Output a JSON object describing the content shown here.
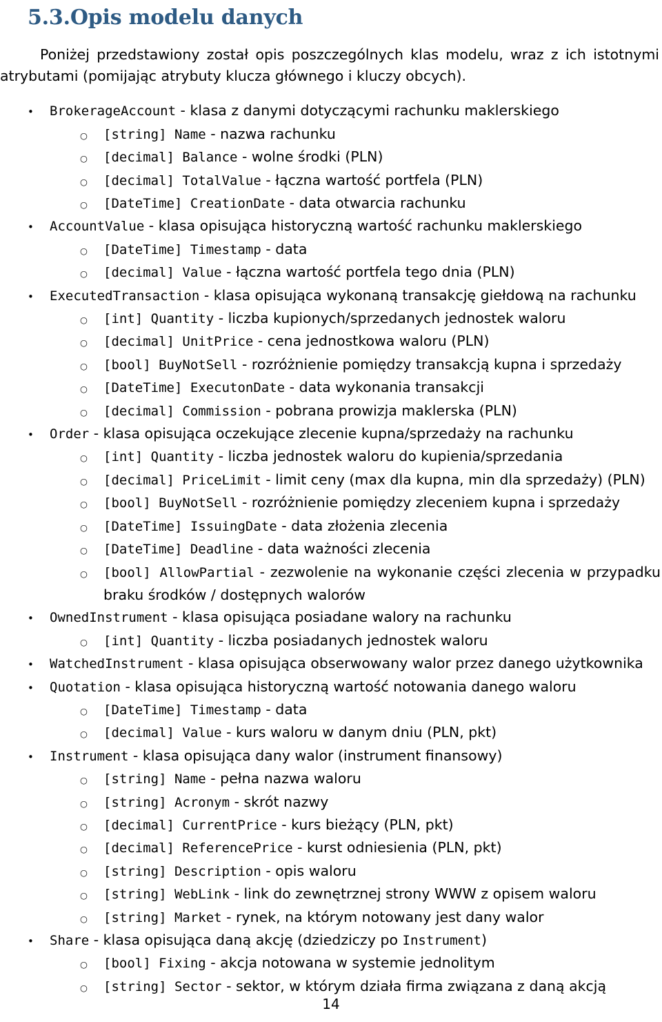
{
  "heading": {
    "number": "5.3.",
    "title": "Opis modelu danych",
    "color": "#2e5b84"
  },
  "intro": "Poniżej przedstawiony został opis poszczególnych klas modelu, wraz z ich istotnymi atrybutami (pomijając atrybuty klucza głównego i kluczy obcych).",
  "bullets": {
    "level1_glyph": "•",
    "level2_glyph": "○"
  },
  "classes": [
    {
      "name": "BrokerageAccount",
      "sep": " - ",
      "desc": "klasa z danymi dotyczącymi rachunku maklerskiego",
      "attributes": [
        {
          "type": "[string]",
          "name": "Name",
          "sep": " - ",
          "desc": "nazwa rachunku"
        },
        {
          "type": "[decimal]",
          "name": "Balance",
          "sep": " - ",
          "desc": "wolne środki (PLN)"
        },
        {
          "type": "[decimal]",
          "name": "TotalValue",
          "sep": " - ",
          "desc": "łączna wartość portfela (PLN)"
        },
        {
          "type": "[DateTime]",
          "name": "CreationDate",
          "sep": " - ",
          "desc": "data otwarcia rachunku"
        }
      ]
    },
    {
      "name": "AccountValue",
      "sep": " - ",
      "desc": "klasa opisująca historyczną wartość rachunku maklerskiego",
      "attributes": [
        {
          "type": "[DateTime]",
          "name": "Timestamp",
          "sep": " - ",
          "desc": "data"
        },
        {
          "type": "[decimal]",
          "name": "Value",
          "sep": " - ",
          "desc": "łączna wartość portfela tego dnia (PLN)"
        }
      ]
    },
    {
      "name": "ExecutedTransaction",
      "sep": " - ",
      "desc": "klasa opisująca wykonaną transakcję giełdową na rachunku",
      "attributes": [
        {
          "type": "[int]",
          "name": "Quantity",
          "sep": " - ",
          "desc": "liczba kupionych/sprzedanych jednostek waloru"
        },
        {
          "type": "[decimal]",
          "name": "UnitPrice",
          "sep": " - ",
          "desc": "cena jednostkowa waloru (PLN)"
        },
        {
          "type": "[bool]",
          "name": "BuyNotSell",
          "sep": " - ",
          "desc": "rozróżnienie pomiędzy transakcją kupna i sprzedaży"
        },
        {
          "type": "[DateTime]",
          "name": "ExecutonDate",
          "sep": " - ",
          "desc": "data wykonania transakcji"
        },
        {
          "type": "[decimal]",
          "name": "Commission",
          "sep": " - ",
          "desc": "pobrana prowizja maklerska (PLN)"
        }
      ]
    },
    {
      "name": "Order",
      "sep": " - ",
      "desc": "klasa opisująca oczekujące zlecenie kupna/sprzedaży na rachunku",
      "attributes": [
        {
          "type": "[int]",
          "name": "Quantity",
          "sep": " - ",
          "desc": "liczba jednostek waloru do kupienia/sprzedania"
        },
        {
          "type": "[decimal]",
          "name": "PriceLimit",
          "sep": " - ",
          "desc": "limit ceny (max dla kupna, min dla sprzedaży) (PLN)"
        },
        {
          "type": "[bool]",
          "name": "BuyNotSell",
          "sep": " - ",
          "desc": "rozróżnienie pomiędzy zleceniem kupna i sprzedaży"
        },
        {
          "type": "[DateTime]",
          "name": "IssuingDate",
          "sep": " - ",
          "desc": "data złożenia zlecenia"
        },
        {
          "type": "[DateTime]",
          "name": "Deadline",
          "sep": " - ",
          "desc": "data ważności zlecenia"
        },
        {
          "type": "[bool]",
          "name": "AllowPartial",
          "sep": " - ",
          "desc": "zezwolenie na wykonanie części zlecenia w przypadku braku środków / dostępnych walorów"
        }
      ]
    },
    {
      "name": "OwnedInstrument",
      "sep": " - ",
      "desc": "klasa opisująca posiadane walory na rachunku",
      "attributes": [
        {
          "type": "[int]",
          "name": "Quantity",
          "sep": " - ",
          "desc": "liczba posiadanych jednostek waloru"
        }
      ]
    },
    {
      "name": "WatchedInstrument",
      "sep": " - ",
      "desc": "klasa opisująca obserwowany walor przez danego użytkownika",
      "attributes": []
    },
    {
      "name": "Quotation",
      "sep": " - ",
      "desc": "klasa opisująca historyczną wartość notowania danego waloru",
      "attributes": [
        {
          "type": "[DateTime]",
          "name": "Timestamp",
          "sep": " - ",
          "desc": "data"
        },
        {
          "type": "[decimal]",
          "name": "Value",
          "sep": " - ",
          "desc": "kurs waloru w danym dniu (PLN, pkt)"
        }
      ]
    },
    {
      "name": "Instrument",
      "sep": " - ",
      "desc": "klasa opisująca dany walor (instrument finansowy)",
      "attributes": [
        {
          "type": "[string]",
          "name": "Name",
          "sep": " - ",
          "desc": "pełna nazwa waloru"
        },
        {
          "type": "[string]",
          "name": "Acronym",
          "sep": " - ",
          "desc": "skrót nazwy"
        },
        {
          "type": "[decimal]",
          "name": "CurrentPrice",
          "sep": " - ",
          "desc": "kurs bieżący (PLN, pkt)"
        },
        {
          "type": "[decimal]",
          "name": "ReferencePrice",
          "sep": " - ",
          "desc": "kurst odniesienia (PLN, pkt)"
        },
        {
          "type": "[string]",
          "name": "Description",
          "sep": " - ",
          "desc": "opis waloru"
        },
        {
          "type": "[string]",
          "name": "WebLink",
          "sep": " - ",
          "desc": "link do zewnętrznej strony WWW z opisem waloru"
        },
        {
          "type": "[string]",
          "name": "Market",
          "sep": " - ",
          "desc": "rynek, na którym notowany jest dany walor"
        }
      ]
    },
    {
      "name": "Share",
      "sep": " - ",
      "desc_pre": "klasa opisująca daną akcję (dziedziczy po ",
      "desc_mono": "Instrument",
      "desc_post": ")",
      "attributes": [
        {
          "type": "[bool]",
          "name": "Fixing",
          "sep": " - ",
          "desc": "akcja notowana w systemie jednolitym"
        },
        {
          "type": "[string]",
          "name": "Sector",
          "sep": " - ",
          "desc": "sektor, w którym działa firma związana z daną akcją"
        }
      ]
    }
  ],
  "page_number": "14"
}
